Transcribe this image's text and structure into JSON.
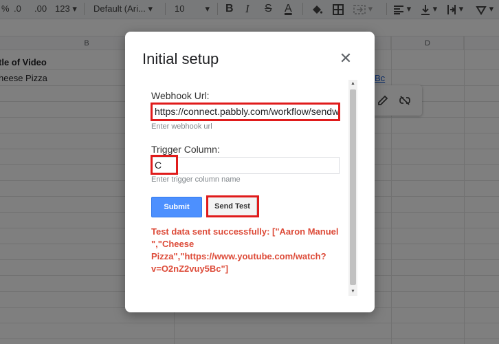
{
  "toolbar": {
    "percent": "%",
    "dec_decrease": ".0",
    "dec_increase": ".00",
    "more_formats": "123",
    "font_family": "Default (Ari...",
    "font_size": "10",
    "bold": "B",
    "italic": "I",
    "strikethrough": "S",
    "text_color": "A"
  },
  "sheet": {
    "col_b": "B",
    "col_d": "D",
    "cell_b1": "tle of Video",
    "cell_b2": "heese Pizza",
    "cell_c2": "Bc"
  },
  "dialog": {
    "title": "Initial setup",
    "webhook_label": "Webhook Url:",
    "webhook_value": "https://connect.pabbly.com/workflow/sendwebhookdata",
    "webhook_hint": "Enter webhook url",
    "trigger_label": "Trigger Column:",
    "trigger_value": "C",
    "trigger_hint": "Enter trigger column name",
    "submit_label": "Submit",
    "send_test_label": "Send Test",
    "success_message": "Test data sent successfully: [\"Aaron Manuel \",\"Cheese Pizza\",\"https://www.youtube.com/watch?v=O2nZ2vuy5Bc\"]"
  },
  "colors": {
    "highlight": "#e01b1b",
    "submit": "#4d90fe",
    "success_text": "#dd4b39",
    "link": "#1155cc"
  },
  "icons": [
    "dropdown-arrow-icon",
    "paint-bucket-icon",
    "borders-icon",
    "merge-cells-icon",
    "align-left-icon",
    "valign-bottom-icon",
    "text-wrap-icon",
    "text-rotate-icon",
    "edit-pencil-icon",
    "unlink-icon",
    "close-icon",
    "scroll-up-icon",
    "scroll-down-icon"
  ]
}
